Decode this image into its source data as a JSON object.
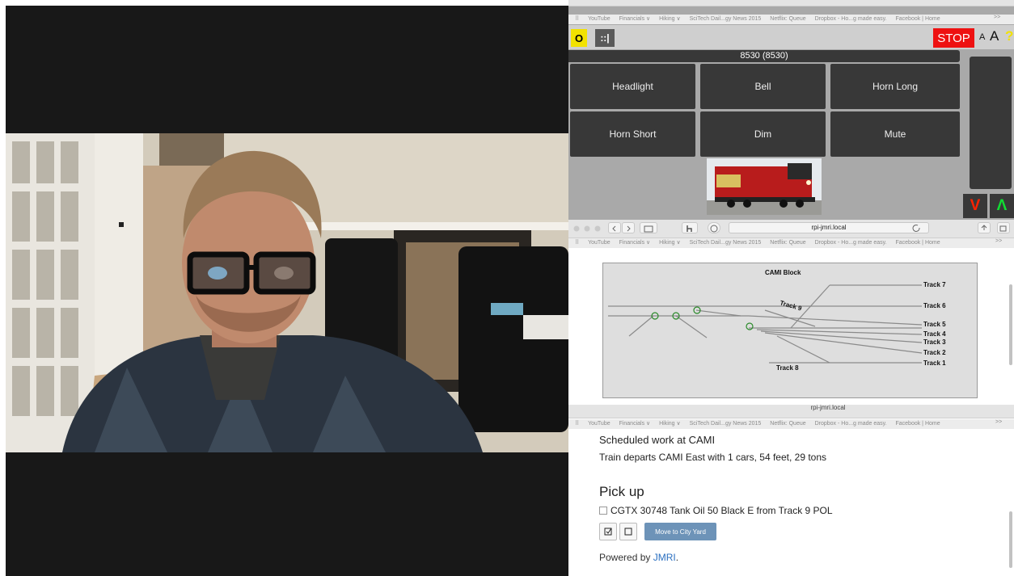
{
  "bookmarks": [
    "YouTube",
    "Financials ∨",
    "Hiking ∨",
    "SciTech Dail...gy News 2015",
    "Netflix: Queue",
    "Dropbox - Ho...g made easy.",
    "Facebook | Home"
  ],
  "bookmarks_overflow": ">>",
  "throttle": {
    "key_o": "O",
    "key_dots": "::|",
    "stop": "STOP",
    "font_small": "A",
    "font_large": "A",
    "help": "?",
    "address": "8530 (8530)",
    "functions": [
      "Headlight",
      "Bell",
      "Horn Long",
      "Horn Short",
      "Dim",
      "Mute"
    ],
    "reverse": "V",
    "forward": "Λ",
    "colors": {
      "stop": "#ee1111",
      "key_o": "#f2e200",
      "reverse": "#ff2200",
      "forward": "#11dd33"
    }
  },
  "panel": {
    "url": "rpi-jmri.local",
    "title": "CAMI Block",
    "tracks": [
      "Track 7",
      "Track 6",
      "Track 5",
      "Track 4",
      "Track 3",
      "Track 2",
      "Track 1"
    ],
    "track9": "Track 9",
    "track8": "Track 8"
  },
  "manifest": {
    "url": "rpi-jmri.local",
    "scheduled": "Scheduled work at CAMI",
    "departs": "Train departs CAMI East with 1 cars, 54 feet, 29 tons",
    "pickup_heading": "Pick up",
    "pickup_item": "CGTX 30748 Tank Oil 50 Black E from Track 9 POL",
    "move_button": "Move to City Yard",
    "powered_by": "Powered by ",
    "jmri_link": "JMRI",
    "period": "."
  }
}
